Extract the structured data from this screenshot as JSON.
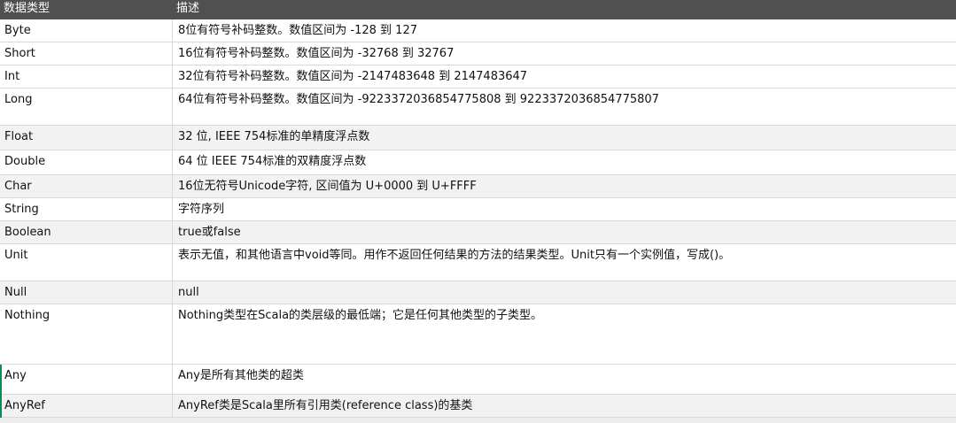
{
  "table": {
    "headers": {
      "type": "数据类型",
      "description": "描述"
    },
    "rows": [
      {
        "type": "Byte",
        "description": "8位有符号补码整数。数值区间为 -128 到 127"
      },
      {
        "type": "Short",
        "description": "16位有符号补码整数。数值区间为 -32768 到 32767"
      },
      {
        "type": "Int",
        "description": "32位有符号补码整数。数值区间为 -2147483648 到 2147483647"
      },
      {
        "type": "Long",
        "description": "64位有符号补码整数。数值区间为 -9223372036854775808 到 9223372036854775807"
      },
      {
        "type": "Float",
        "description": "32 位, IEEE 754标准的单精度浮点数"
      },
      {
        "type": "Double",
        "description": "64 位 IEEE 754标准的双精度浮点数"
      },
      {
        "type": "Char",
        "description": "16位无符号Unicode字符, 区间值为 U+0000 到 U+FFFF"
      },
      {
        "type": "String",
        "description": "字符序列"
      },
      {
        "type": "Boolean",
        "description": "true或false"
      },
      {
        "type": "Unit",
        "description": "表示无值，和其他语言中void等同。用作不返回任何结果的方法的结果类型。Unit只有一个实例值，写成()。"
      },
      {
        "type": "Null",
        "description": "null"
      },
      {
        "type": "Nothing",
        "description": "Nothing类型在Scala的类层级的最低端；它是任何其他类型的子类型。"
      },
      {
        "type": "Any",
        "description": "Any是所有其他类的超类"
      },
      {
        "type": "AnyRef",
        "description": "AnyRef类是Scala里所有引用类(reference class)的基类"
      }
    ]
  }
}
